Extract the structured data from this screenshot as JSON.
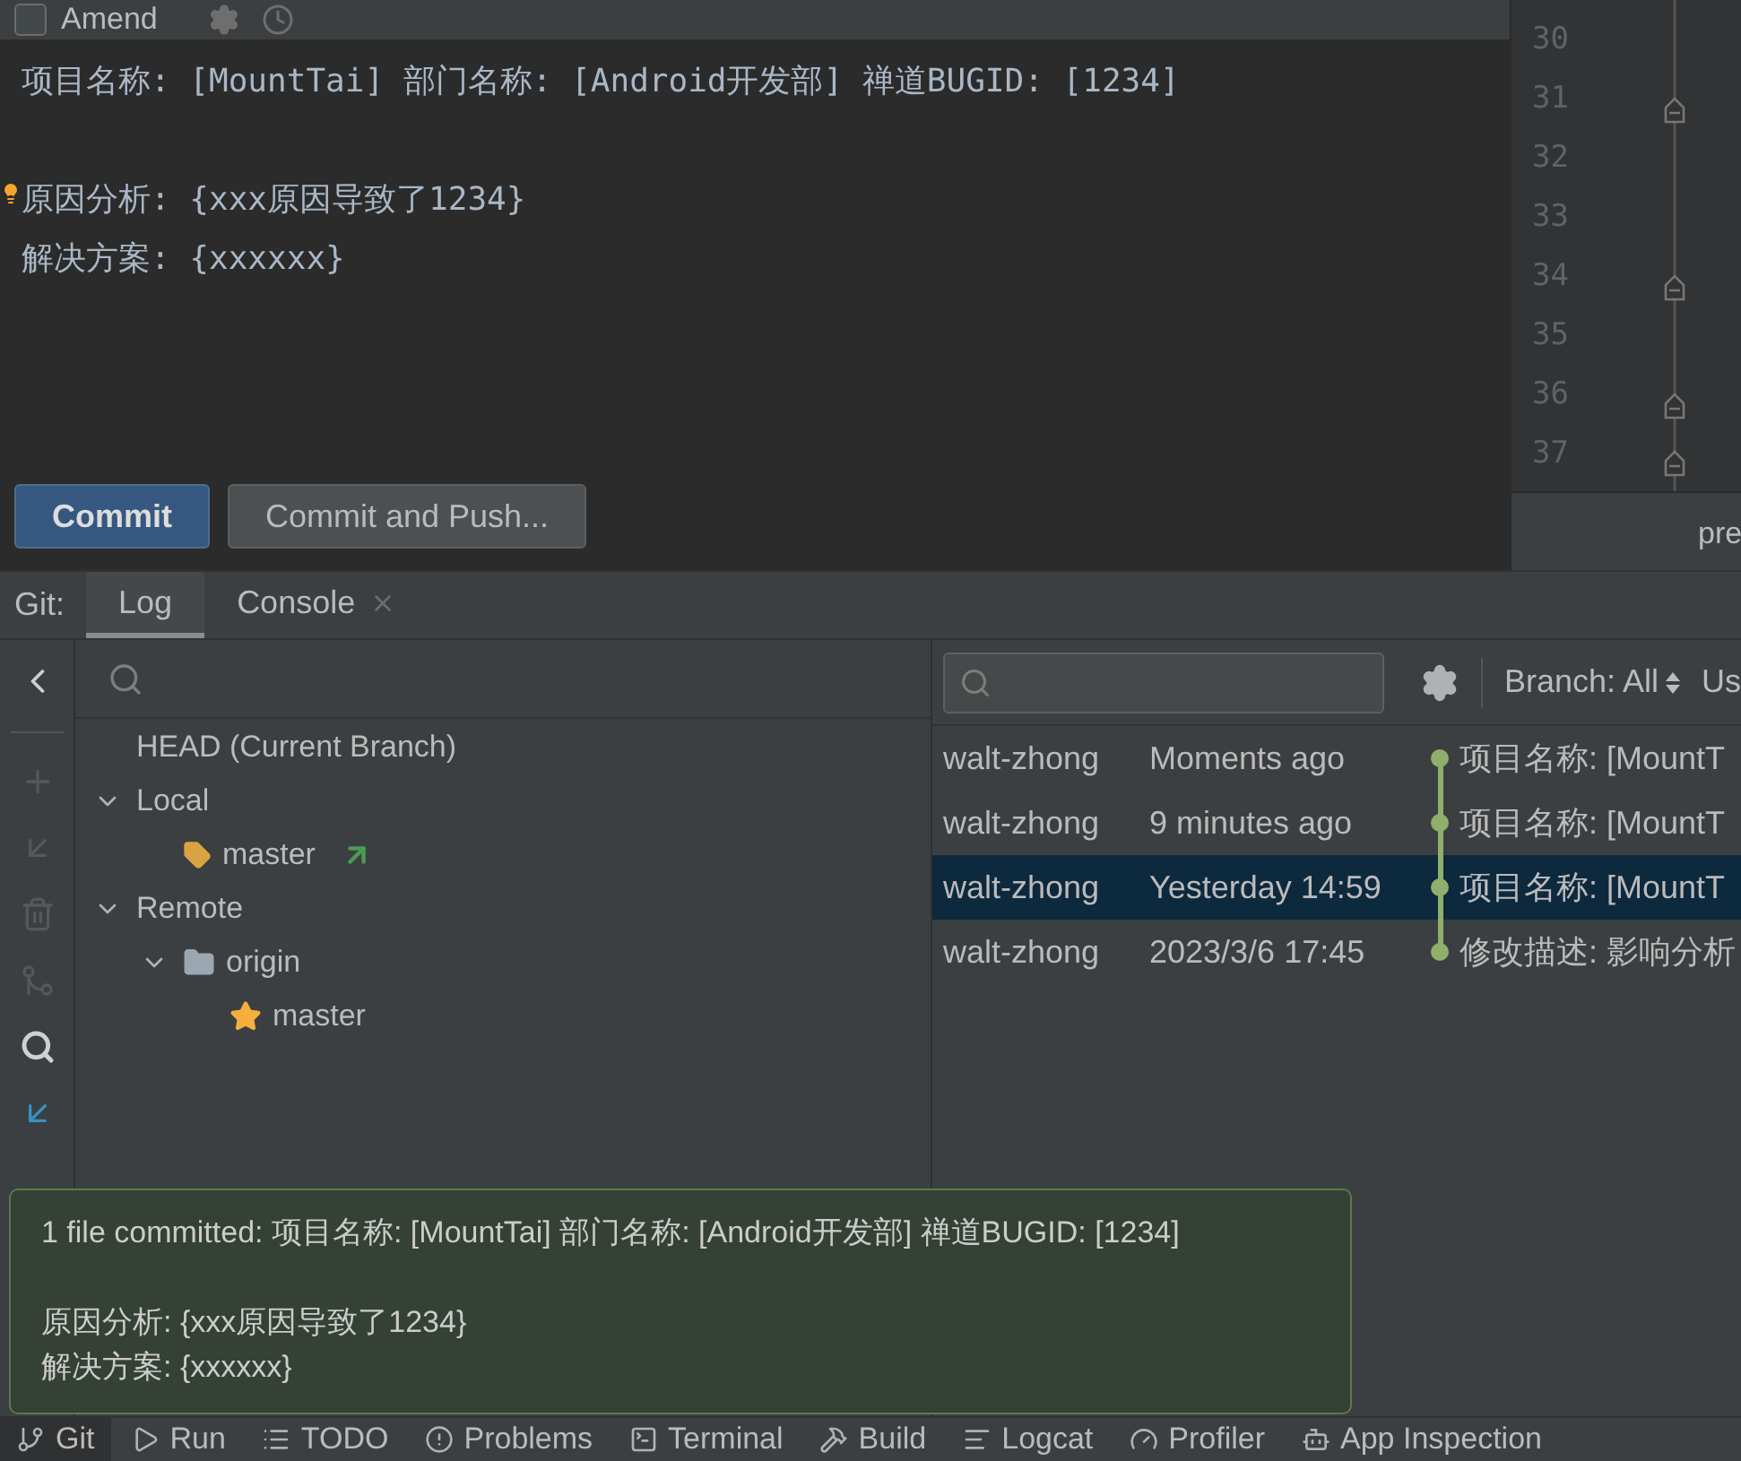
{
  "commit_panel": {
    "amend": {
      "label": "Amend",
      "checked": false
    },
    "message_lines": [
      "项目名称: [MountTai] 部门名称: [Android开发部] 禅道BUGID: [1234]",
      "原因分析: {xxx原因导致了1234}",
      "解决方案: {xxxxxx}"
    ],
    "buttons": [
      {
        "label": "Commit",
        "kind": "primary"
      },
      {
        "label": "Commit and Push...",
        "kind": "secondary"
      }
    ]
  },
  "editor_gutter": {
    "line_numbers": [
      "30",
      "31",
      "32",
      "33",
      "34",
      "35",
      "36",
      "37"
    ],
    "tab_label": "pre"
  },
  "git_tool_window": {
    "title": "Git:",
    "tabs": [
      {
        "label": "Log",
        "selected": true,
        "closable": false
      },
      {
        "label": "Console",
        "selected": false,
        "closable": true
      }
    ],
    "branches": [
      {
        "label": "HEAD (Current Branch)"
      },
      {
        "label": "Local",
        "expanded": true,
        "children": [
          {
            "label": "master",
            "kind": "branch"
          }
        ]
      },
      {
        "label": "Remote",
        "expanded": true,
        "children": [
          {
            "label": "origin",
            "kind": "folder",
            "expanded": true,
            "children": [
              {
                "label": "master",
                "kind": "favorite"
              }
            ]
          }
        ]
      }
    ],
    "log_toolbar": {
      "branch_filter": "Branch: All",
      "user_filter": "Us"
    },
    "commits": [
      {
        "author": "walt-zhong",
        "date": "Moments ago",
        "message": "项目名称: [MountT",
        "selected": false
      },
      {
        "author": "walt-zhong",
        "date": "9 minutes ago",
        "message": "项目名称: [MountT",
        "selected": false
      },
      {
        "author": "walt-zhong",
        "date": "Yesterday 14:59",
        "message": "项目名称: [MountT",
        "selected": true
      },
      {
        "author": "walt-zhong",
        "date": "2023/3/6 17:45",
        "message": "修改描述:  影响分析",
        "selected": false
      }
    ]
  },
  "notification": {
    "lines": [
      "1 file committed: 项目名称: [MountTai] 部门名称: [Android开发部] 禅道BUGID: [1234]",
      "原因分析: {xxx原因导致了1234}",
      "解决方案: {xxxxxx}"
    ]
  },
  "bottom_toolbar": [
    {
      "label": "Git",
      "kind": "git",
      "selected": true
    },
    {
      "label": "Run",
      "kind": "run",
      "selected": false
    },
    {
      "label": "TODO",
      "kind": "list",
      "selected": false
    },
    {
      "label": "Problems",
      "kind": "alert",
      "selected": false
    },
    {
      "label": "Terminal",
      "kind": "terminal",
      "selected": false
    },
    {
      "label": "Build",
      "kind": "hammer",
      "selected": false
    },
    {
      "label": "Logcat",
      "kind": "log",
      "selected": false
    },
    {
      "label": "Profiler",
      "kind": "gauge",
      "selected": false
    },
    {
      "label": "App Inspection",
      "kind": "robot",
      "selected": false
    }
  ]
}
